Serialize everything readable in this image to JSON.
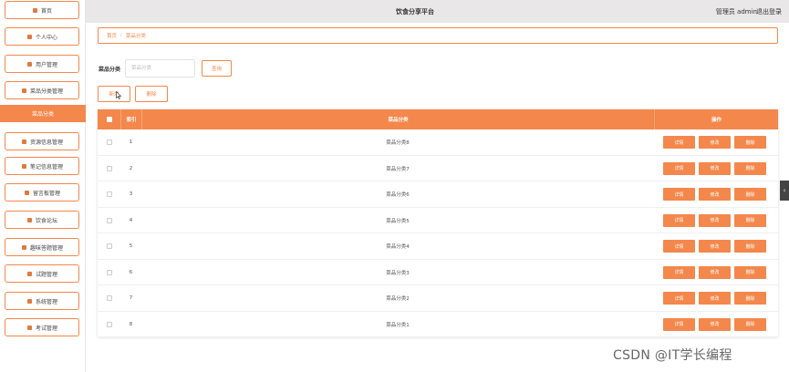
{
  "app": {
    "title": "饮食分享平台",
    "user": "管理员 admin",
    "logout": "退出登录"
  },
  "sidebar": {
    "items": [
      {
        "label": "首页",
        "icon": "home-icon",
        "active": false
      },
      {
        "label": "个人中心",
        "icon": "user-icon",
        "active": false
      },
      {
        "label": "用户管理",
        "icon": "grid-icon",
        "active": false
      },
      {
        "label": "菜品分类管理",
        "icon": "grid-icon",
        "active": false
      },
      {
        "label": "菜品分类",
        "icon": "",
        "active": true
      },
      {
        "label": "资源信息管理",
        "icon": "flag-icon",
        "active": false
      },
      {
        "label": "笔记信息管理",
        "icon": "note-icon",
        "active": false
      },
      {
        "label": "留言板管理",
        "icon": "chart-icon",
        "active": false
      },
      {
        "label": "饮食论坛",
        "icon": "grid-icon",
        "active": false
      },
      {
        "label": "趣味答题管理",
        "icon": "monitor-icon",
        "active": false
      },
      {
        "label": "试题管理",
        "icon": "grid-icon",
        "active": false
      },
      {
        "label": "系统管理",
        "icon": "grid-icon",
        "active": false
      },
      {
        "label": "考试管理",
        "icon": "monitor-icon",
        "active": false
      }
    ]
  },
  "breadcrumb": {
    "home": "首页",
    "current": "菜品分类"
  },
  "search": {
    "label": "菜品分类",
    "placeholder": "菜品分类",
    "value": "",
    "button": "查询"
  },
  "toolbar": {
    "add": "新增",
    "delete": "删除"
  },
  "table": {
    "headers": {
      "index": "索引",
      "category": "菜品分类",
      "actions": "操作"
    },
    "rows": [
      {
        "index": "1",
        "category": "菜品分类8"
      },
      {
        "index": "2",
        "category": "菜品分类7"
      },
      {
        "index": "3",
        "category": "菜品分类6"
      },
      {
        "index": "4",
        "category": "菜品分类5"
      },
      {
        "index": "5",
        "category": "菜品分类4"
      },
      {
        "index": "6",
        "category": "菜品分类3"
      },
      {
        "index": "7",
        "category": "菜品分类2"
      },
      {
        "index": "8",
        "category": "菜品分类1"
      }
    ],
    "action_labels": {
      "detail": "详情",
      "edit": "修改",
      "delete": "删除"
    }
  },
  "side_toggle": "‹",
  "watermark": "CSDN @IT学长编程",
  "colors": {
    "accent": "#f4874b",
    "topbar": "#e9e7e7"
  }
}
